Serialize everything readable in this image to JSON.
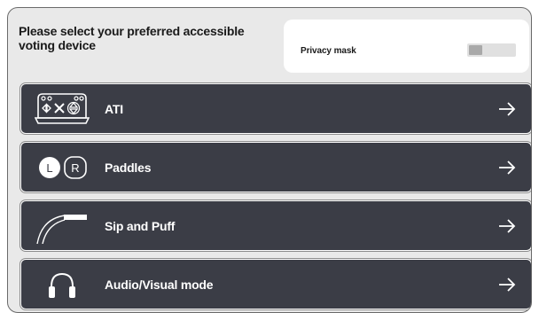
{
  "header": {
    "title": "Please select your preferred accessible voting device"
  },
  "privacy": {
    "label": "Privacy mask",
    "enabled": false
  },
  "devices": [
    {
      "label": "ATI",
      "icon": "ati-controller-icon"
    },
    {
      "label": "Paddles",
      "icon": "paddles-icon"
    },
    {
      "label": "Sip and Puff",
      "icon": "sip-puff-icon"
    },
    {
      "label": "Audio/Visual mode",
      "icon": "headphones-icon"
    }
  ]
}
